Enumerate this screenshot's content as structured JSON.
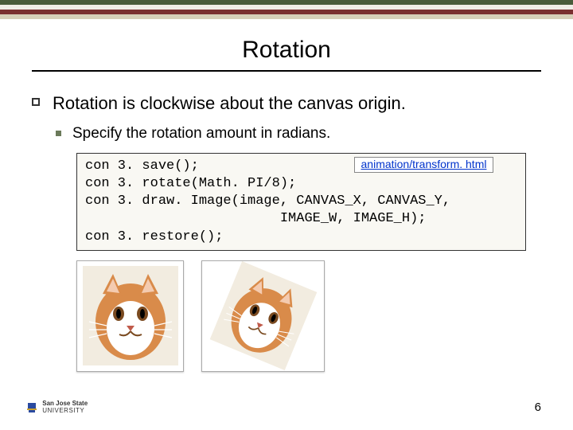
{
  "title": "Rotation",
  "bullets": {
    "main": "Rotation is clockwise about the canvas origin.",
    "sub": "Specify the rotation amount in radians."
  },
  "code": {
    "line1": "con 3. save();",
    "line2": "con 3. rotate(Math. PI/8);",
    "line3": "con 3. draw. Image(image, CANVAS_X, CANVAS_Y,",
    "line4": "                        IMAGE_W, IMAGE_H);",
    "line5": "con 3. restore();"
  },
  "link": {
    "text": "animation/transform. html",
    "href": "#"
  },
  "logo": {
    "line1": "San Jose State",
    "line2": "UNIVERSITY"
  },
  "page_number": "6"
}
